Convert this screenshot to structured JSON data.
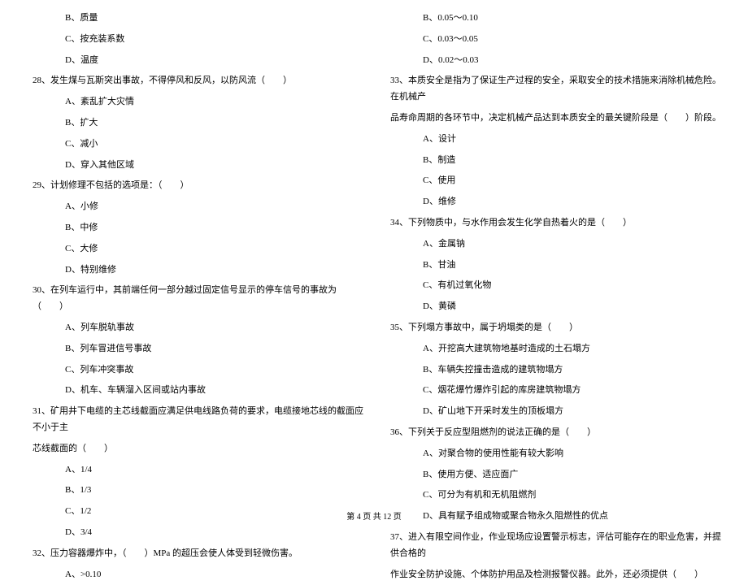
{
  "left": {
    "q27_opts": [
      "B、质量",
      "C、按充装系数",
      "D、温度"
    ],
    "q28": "28、发生煤与瓦斯突出事故，不得停风和反风，以防风流（　　）",
    "q28_opts": [
      "A、紊乱扩大灾情",
      "B、扩大",
      "C、减小",
      "D、穿入其他区域"
    ],
    "q29": "29、计划修理不包括的选项是：（　　）",
    "q29_opts": [
      "A、小修",
      "B、中修",
      "C、大修",
      "D、特别维修"
    ],
    "q30": "30、在列车运行中，其前端任何一部分越过固定信号显示的停车信号的事故为（　　）",
    "q30_opts": [
      "A、列车脱轨事故",
      "B、列车冒进信号事故",
      "C、列车冲突事故",
      "D、机车、车辆溜入区间或站内事故"
    ],
    "q31": "31、矿用井下电缆的主芯线截面应满足供电线路负荷的要求，电缆接地芯线的截面应不小于主",
    "q31_cont": "芯线截面的（　　）",
    "q31_opts": [
      "A、1/4",
      "B、1/3",
      "C、1/2",
      "D、3/4"
    ],
    "q32": "32、压力容器爆炸中，（　　）MPa 的超压会使人体受到轻微伤害。",
    "q32_opts": [
      "A、>0.10"
    ]
  },
  "right": {
    "q32_opts_cont": [
      "B、0.05～0.10",
      "C、0.03～0.05",
      "D、0.02～0.03"
    ],
    "q33": "33、本质安全是指为了保证生产过程的安全，采取安全的技术措施来消除机械危险。在机械产",
    "q33_cont": "品寿命周期的各环节中，决定机械产品达到本质安全的最关键阶段是（　　）阶段。",
    "q33_opts": [
      "A、设计",
      "B、制造",
      "C、使用",
      "D、维修"
    ],
    "q34": "34、下列物质中，与水作用会发生化学自热着火的是（　　）",
    "q34_opts": [
      "A、金属钠",
      "B、甘油",
      "C、有机过氧化物",
      "D、黄磷"
    ],
    "q35": "35、下列塌方事故中，属于坍塌类的是（　　）",
    "q35_opts": [
      "A、开挖高大建筑物地基时造成的土石塌方",
      "B、车辆失控撞击造成的建筑物塌方",
      "C、烟花爆竹爆炸引起的库房建筑物塌方",
      "D、矿山地下开采时发生的顶板塌方"
    ],
    "q36": "36、下列关于反应型阻燃剂的说法正确的是（　　）",
    "q36_opts": [
      "A、对聚合物的使用性能有较大影响",
      "B、使用方便、适应面广",
      "C、可分为有机和无机阻燃剂",
      "D、具有赋予组成物或聚合物永久阻燃性的优点"
    ],
    "q37": "37、进入有限空间作业，作业现场应设置警示标志，评估可能存在的职业危害，并提供合格的",
    "q37_cont": "作业安全防护设施、个体防护用品及检测报警仪器。此外，还必须提供（　　）"
  },
  "footer": "第 4 页 共 12 页"
}
